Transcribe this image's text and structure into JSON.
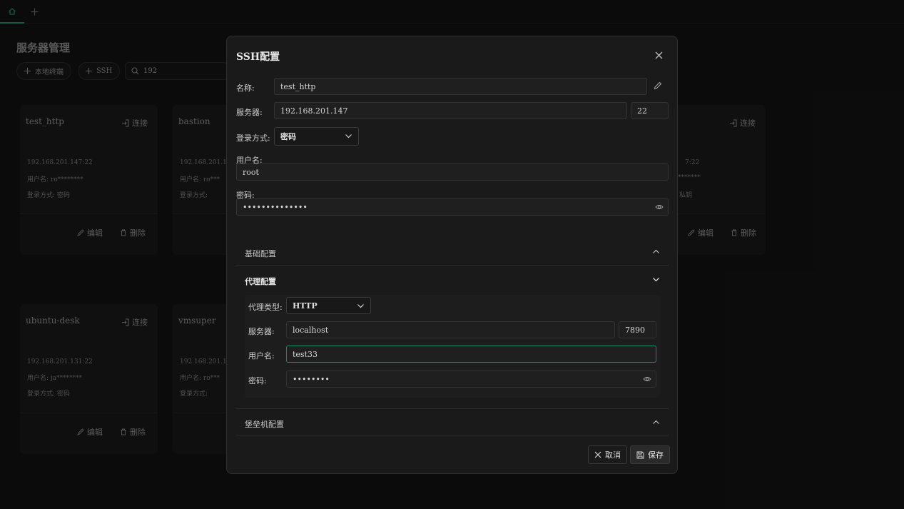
{
  "background": {
    "page_title": "服务器管理",
    "toolbar": {
      "local_terminal_label": "本地终端",
      "ssh_label": "SSH",
      "search_value": "192"
    },
    "cards": [
      {
        "name": "test_http",
        "connect_label": "连接",
        "address": "192.168.201.147:22",
        "user_line": "用户名:   ro********",
        "login_line": "登录方式:   密码",
        "edit_label": "编辑",
        "delete_label": "删除"
      },
      {
        "name": "bastion",
        "address": "192.168.201.147:",
        "user_line": "用户名:   ro***",
        "login_line": "登录方式:"
      },
      {
        "connect_label": "连接",
        "address": "7:22",
        "user_line": "*******",
        "login_line": "私钥",
        "edit_label": "编辑",
        "delete_label": "删除"
      },
      {
        "name": "ubuntu-desk",
        "connect_label": "连接",
        "address": "192.168.201.131:22",
        "user_line": "用户名:   ja********",
        "login_line": "登录方式:   密码",
        "edit_label": "编辑",
        "delete_label": "删除"
      },
      {
        "name": "vmsuper",
        "address": "192.168.201.129",
        "user_line": "用户名:   ro***",
        "login_line": "登录方式:"
      }
    ]
  },
  "modal": {
    "title": "SSH配置",
    "name_label": "名称:",
    "name_value": "test_http",
    "server_label": "服务器:",
    "server_value": "192.168.201.147",
    "port_value": "22",
    "login_method_label": "登录方式:",
    "login_method_value": "密码",
    "username_label": "用户名:",
    "username_value": "root",
    "password_label": "密码:",
    "password_value": "••••••••••••••",
    "sections": {
      "basic": "基础配置",
      "proxy": "代理配置",
      "bastion": "堡垒机配置"
    },
    "proxy": {
      "type_label": "代理类型:",
      "type_value": "HTTP",
      "server_label": "服务器:",
      "server_value": "localhost",
      "port_value": "7890",
      "username_label": "用户名:",
      "username_value": "test33",
      "password_label": "密码:",
      "password_value": "••••••••"
    },
    "cancel_label": "取消",
    "save_label": "保存"
  },
  "colors": {
    "accent": "#1f8a70",
    "background": "#121212",
    "modal_bg": "#1a1a1a"
  }
}
